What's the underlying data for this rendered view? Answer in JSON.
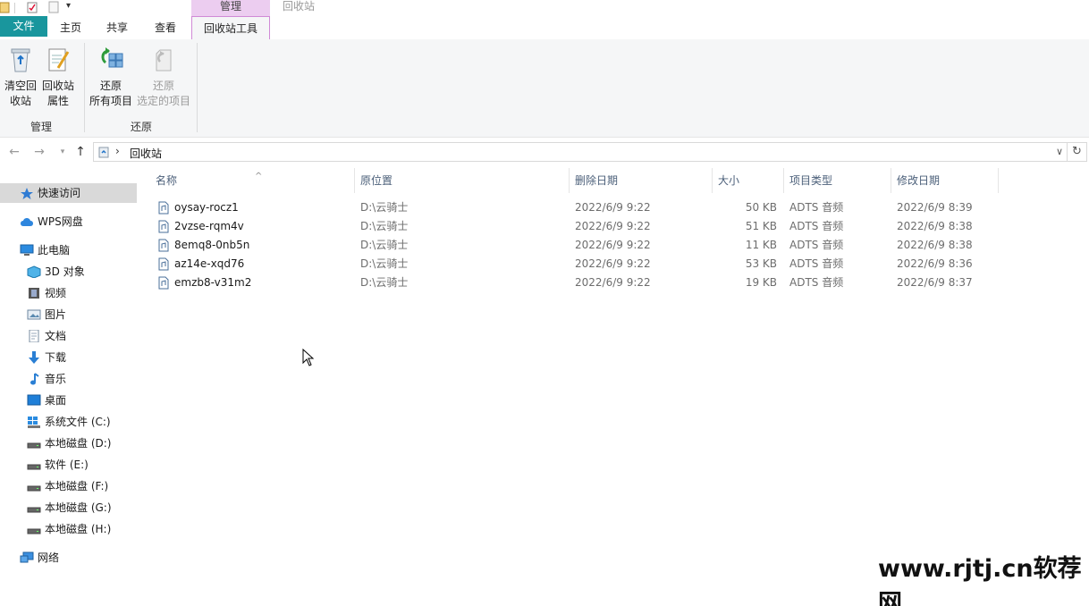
{
  "titlebar": {
    "context_tab": "管理",
    "title": "回收站"
  },
  "ribbon_tabs": {
    "file": "文件",
    "home": "主页",
    "share": "共享",
    "view": "查看",
    "recycle_tools": "回收站工具"
  },
  "ribbon": {
    "empty_bin": [
      "清空回",
      "收站"
    ],
    "bin_props": [
      "回收站",
      "属性"
    ],
    "restore_all": [
      "还原",
      "所有项目"
    ],
    "restore_selected": [
      "还原",
      "选定的项目"
    ],
    "group_manage": "管理",
    "group_restore": "还原"
  },
  "address": {
    "crumb": "回收站"
  },
  "sidebar": {
    "items": [
      {
        "label": "快速访问",
        "icon": "star-icon"
      },
      {
        "label": "WPS网盘",
        "icon": "cloud-icon"
      },
      {
        "label": "此电脑",
        "icon": "computer-icon"
      },
      {
        "label": "3D 对象",
        "icon": "cube-icon"
      },
      {
        "label": "视频",
        "icon": "video-icon"
      },
      {
        "label": "图片",
        "icon": "picture-icon"
      },
      {
        "label": "文档",
        "icon": "document-icon"
      },
      {
        "label": "下载",
        "icon": "download-icon"
      },
      {
        "label": "音乐",
        "icon": "music-icon"
      },
      {
        "label": "桌面",
        "icon": "desktop-icon"
      },
      {
        "label": "系统文件 (C:)",
        "icon": "windows-drive-icon"
      },
      {
        "label": "本地磁盘 (D:)",
        "icon": "drive-icon"
      },
      {
        "label": "软件 (E:)",
        "icon": "drive-icon"
      },
      {
        "label": "本地磁盘 (F:)",
        "icon": "drive-icon"
      },
      {
        "label": "本地磁盘 (G:)",
        "icon": "drive-icon"
      },
      {
        "label": "本地磁盘 (H:)",
        "icon": "drive-icon"
      },
      {
        "label": "网络",
        "icon": "network-icon"
      }
    ]
  },
  "columns": [
    "名称",
    "原位置",
    "删除日期",
    "大小",
    "项目类型",
    "修改日期"
  ],
  "files": [
    {
      "name": "oysay-rocz1",
      "location": "D:\\云骑士",
      "deleted": "2022/6/9 9:22",
      "size": "50 KB",
      "type": "ADTS 音频",
      "modified": "2022/6/9 8:39"
    },
    {
      "name": "2vzse-rqm4v",
      "location": "D:\\云骑士",
      "deleted": "2022/6/9 9:22",
      "size": "51 KB",
      "type": "ADTS 音频",
      "modified": "2022/6/9 8:38"
    },
    {
      "name": "8emq8-0nb5n",
      "location": "D:\\云骑士",
      "deleted": "2022/6/9 9:22",
      "size": "11 KB",
      "type": "ADTS 音频",
      "modified": "2022/6/9 8:38"
    },
    {
      "name": "az14e-xqd76",
      "location": "D:\\云骑士",
      "deleted": "2022/6/9 9:22",
      "size": "53 KB",
      "type": "ADTS 音频",
      "modified": "2022/6/9 8:36"
    },
    {
      "name": "emzb8-v31m2",
      "location": "D:\\云骑士",
      "deleted": "2022/6/9 9:22",
      "size": "19 KB",
      "type": "ADTS 音频",
      "modified": "2022/6/9 8:37"
    }
  ],
  "watermark": "www.rjtj.cn软荐网",
  "colors": {
    "file_tab": "#19969d",
    "context_tab": "#eccdf0",
    "selected_nav": "#d9d9d9"
  }
}
